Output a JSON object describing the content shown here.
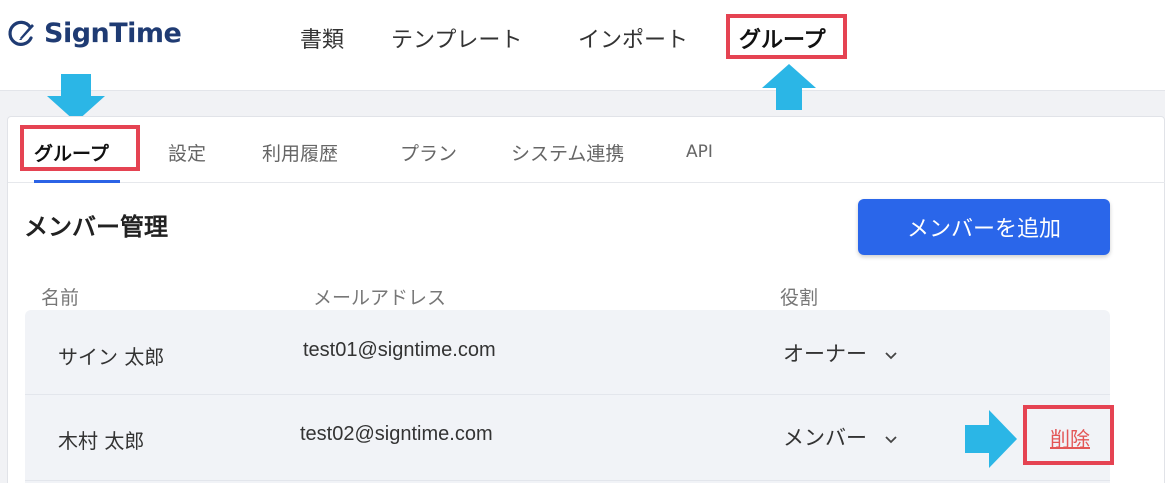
{
  "header": {
    "logo_text": "SignTime",
    "nav": [
      {
        "label": "書類"
      },
      {
        "label": "テンプレート"
      },
      {
        "label": "インポート"
      },
      {
        "label": "グループ"
      }
    ]
  },
  "tabs": [
    {
      "label": "グループ"
    },
    {
      "label": "設定"
    },
    {
      "label": "利用履歴"
    },
    {
      "label": "プラン"
    },
    {
      "label": "システム連携"
    },
    {
      "label": "API"
    }
  ],
  "section": {
    "title": "メンバー管理",
    "add_button_label": "メンバーを追加"
  },
  "table": {
    "columns": [
      "名前",
      "メールアドレス",
      "役割"
    ],
    "rows": [
      {
        "name": "サイン 太郎",
        "email": "test01@signtime.com",
        "role": "オーナー",
        "action": ""
      },
      {
        "name": "木村 太郎",
        "email": "test02@signtime.com",
        "role": "メンバー",
        "action": "削除"
      }
    ]
  },
  "colors": {
    "accent": "#2a66ea",
    "highlight": "#e54352",
    "arrow": "#2bb6e6",
    "brand": "#1f3b73",
    "delete": "#e35656"
  }
}
